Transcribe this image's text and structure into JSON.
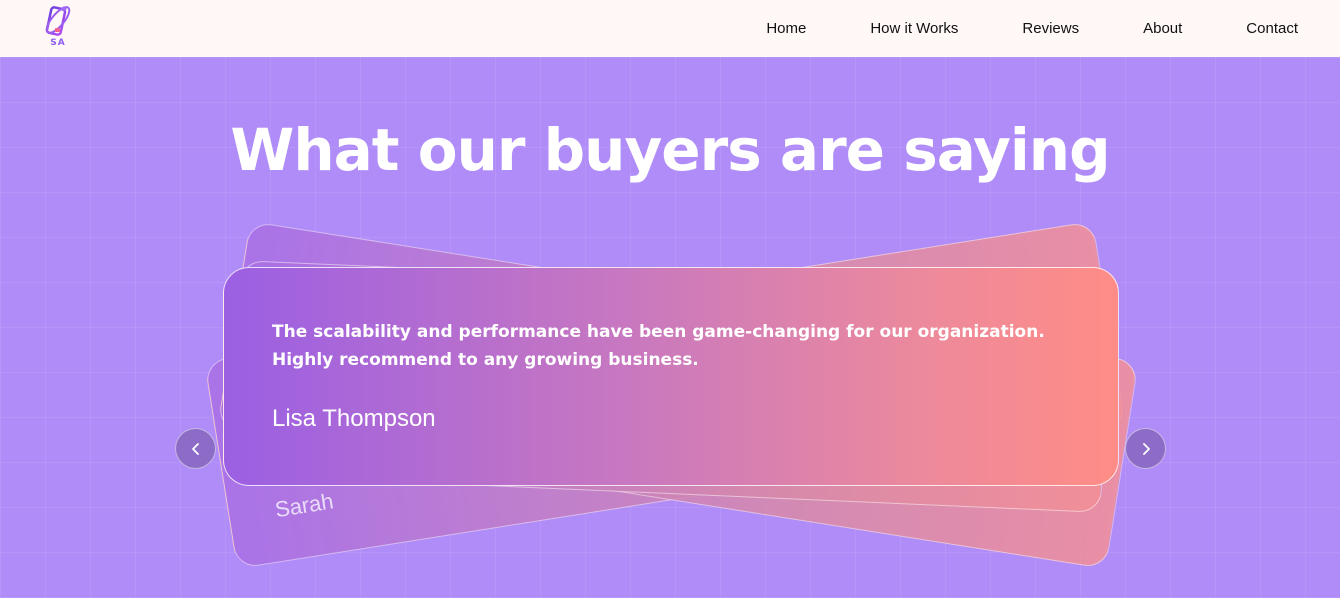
{
  "brand": {
    "logo_text": "SA",
    "logo_icon": "phone-orbit-logo",
    "accent": "#8e5df0"
  },
  "nav": {
    "items": [
      {
        "label": "Home"
      },
      {
        "label": "How it Works"
      },
      {
        "label": "Reviews"
      },
      {
        "label": "About"
      },
      {
        "label": "Contact"
      }
    ]
  },
  "testimonials": {
    "title": "What our buyers are saying",
    "active": {
      "quote": "The scalability and performance have been game-changing for our organization. Highly recommend to any growing business.",
      "author": "Lisa Thompson"
    },
    "behind_author_partial": "Sarah",
    "prev_icon": "chevron-left-icon",
    "next_icon": "chevron-right-icon"
  },
  "colors": {
    "background": "#b08cf8",
    "navbar": "#fff8f6",
    "card_start": "#9b5fe3",
    "card_end": "#ff8c86"
  }
}
